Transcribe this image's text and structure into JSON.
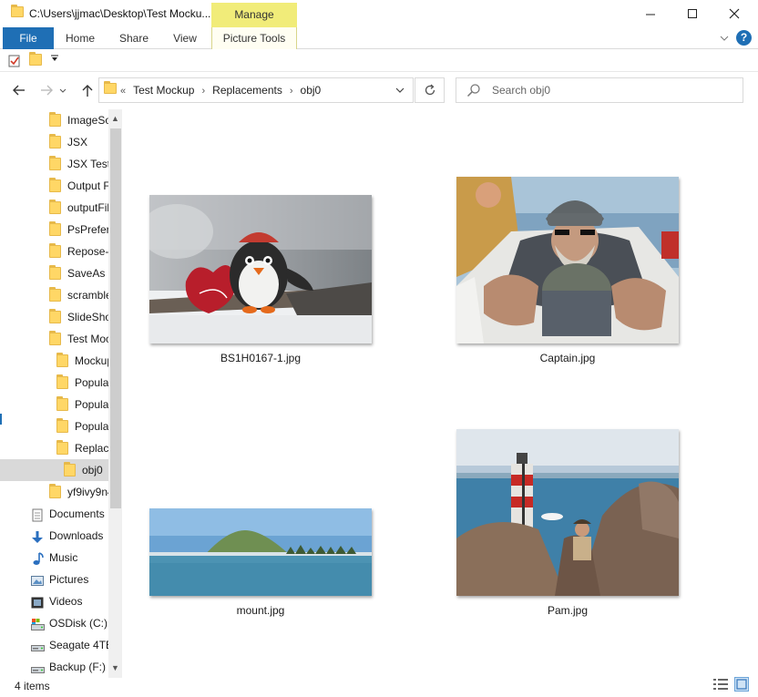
{
  "window": {
    "title": "C:\\Users\\jjmac\\Desktop\\Test Mockup\\Replacements\\obj0",
    "title_visible": "C:\\Users\\jjmac\\Desktop\\Test Mocku..."
  },
  "ribbon": {
    "contextual_group": "Manage",
    "tabs": [
      {
        "label": "File"
      },
      {
        "label": "Home"
      },
      {
        "label": "Share"
      },
      {
        "label": "View"
      },
      {
        "label": "Picture Tools"
      }
    ]
  },
  "address": {
    "overflow": "«",
    "crumbs": [
      "Test Mockup",
      "Replacements",
      "obj0"
    ]
  },
  "search": {
    "placeholder": "Search obj0"
  },
  "nav_pane": {
    "items": [
      {
        "label": "ImageSou",
        "icon": "folder-icon",
        "indent": 1
      },
      {
        "label": "JSX",
        "icon": "folder-icon",
        "indent": 1
      },
      {
        "label": "JSX Test",
        "icon": "folder-icon",
        "indent": 1
      },
      {
        "label": "Output Fo",
        "icon": "folder-icon",
        "indent": 1
      },
      {
        "label": "outputFile",
        "icon": "folder-icon",
        "indent": 1
      },
      {
        "label": "PsPreferer",
        "icon": "folder-icon",
        "indent": 1
      },
      {
        "label": "Repose-Iso",
        "icon": "folder-icon",
        "indent": 1
      },
      {
        "label": "SaveAs",
        "icon": "folder-icon",
        "indent": 1
      },
      {
        "label": "scramble-t",
        "icon": "folder-icon",
        "indent": 1
      },
      {
        "label": "SlideShow",
        "icon": "folder-icon",
        "indent": 1
      },
      {
        "label": "Test Mock",
        "icon": "folder-icon",
        "indent": 1
      },
      {
        "label": "Mockups",
        "icon": "folder-icon",
        "indent": 2
      },
      {
        "label": "Populate",
        "icon": "folder-icon",
        "indent": 2
      },
      {
        "label": "Populate",
        "icon": "folder-icon",
        "indent": 2
      },
      {
        "label": "Populate",
        "icon": "folder-icon",
        "indent": 2
      },
      {
        "label": "Replacer",
        "icon": "folder-icon",
        "indent": 2
      },
      {
        "label": "obj0",
        "icon": "folder-icon",
        "indent": 3,
        "selected": true
      },
      {
        "label": "yf9ivy9n4r",
        "icon": "folder-icon",
        "indent": 1
      },
      {
        "label": "Documents",
        "icon": "documents-icon",
        "indent": 0
      },
      {
        "label": "Downloads",
        "icon": "downloads-icon",
        "indent": 0
      },
      {
        "label": "Music",
        "icon": "music-icon",
        "indent": 0
      },
      {
        "label": "Pictures",
        "icon": "pictures-icon",
        "indent": 0
      },
      {
        "label": "Videos",
        "icon": "videos-icon",
        "indent": 0
      },
      {
        "label": "OSDisk (C:)",
        "icon": "os-drive-icon",
        "indent": 0
      },
      {
        "label": "Seagate 4TB",
        "icon": "drive-icon",
        "indent": 0
      },
      {
        "label": "Backup (F:)",
        "icon": "drive-icon",
        "indent": 0
      }
    ]
  },
  "files": [
    {
      "name": "BS1H0167-1.jpg",
      "subject": "penguin-photo"
    },
    {
      "name": "Captain.jpg",
      "subject": "captain-photo"
    },
    {
      "name": "mount.jpg",
      "subject": "mountain-photo"
    },
    {
      "name": "Pam.jpg",
      "subject": "lighthouse-photo"
    }
  ],
  "status": {
    "item_count": "4 items"
  },
  "colors": {
    "file_tab": "#1f6fb5",
    "manage_tab": "#f1ec79",
    "selection": "#d9d9d9",
    "folder": "#ffd766"
  }
}
